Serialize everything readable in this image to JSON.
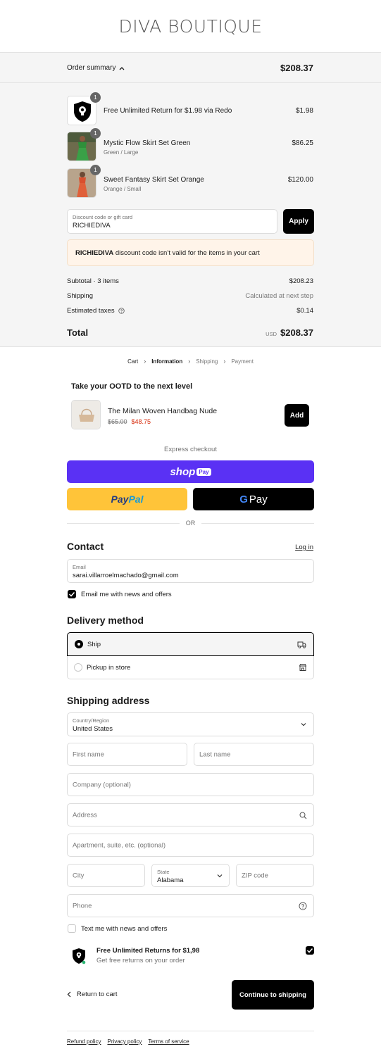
{
  "brand": {
    "logo_text": "DIVA BOUTIQUE"
  },
  "summary": {
    "toggle_label": "Order summary",
    "total": "$208.37",
    "items": [
      {
        "name": "Free Unlimited Return for $1.98 via Redo",
        "variant": "",
        "price": "$1.98",
        "qty": "1",
        "image": "redo-shield-icon"
      },
      {
        "name": "Mystic Flow Skirt Set Green",
        "variant": "Green / Large",
        "price": "$86.25",
        "qty": "1",
        "image": "green-skirt-set-photo"
      },
      {
        "name": "Sweet Fantasy Skirt Set Orange",
        "variant": "Orange / Small",
        "price": "$120.00",
        "qty": "1",
        "image": "orange-skirt-set-photo"
      }
    ],
    "discount": {
      "label": "Discount code or gift card",
      "value": "RICHIEDIVA",
      "apply_label": "Apply"
    },
    "notice": {
      "code": "RICHIEDIVA",
      "message": "discount code isn’t valid for the items in your cart"
    },
    "subtotal_label": "Subtotal · 3 items",
    "subtotal_value": "$208.23",
    "shipping_label": "Shipping",
    "shipping_value": "Calculated at next step",
    "taxes_label": "Estimated taxes",
    "taxes_value": "$0.14",
    "total_label": "Total",
    "currency": "USD",
    "total_value": "$208.37"
  },
  "breadcrumbs": [
    "Cart",
    "Information",
    "Shipping",
    "Payment"
  ],
  "upsell": {
    "title": "Take your OOTD to the next level",
    "product": "The Milan Woven Handbag Nude",
    "old_price": "$65.00",
    "new_price": "$48.75",
    "add_label": "Add"
  },
  "express": {
    "label": "Express checkout",
    "shop_text": "shop",
    "shop_pay_badge": "Pay",
    "paypal_text_1": "Pay",
    "paypal_text_2": "Pal",
    "gpay_g": "G",
    "gpay_text": "Pay",
    "or_label": "OR"
  },
  "contact": {
    "title": "Contact",
    "login_label": "Log in",
    "email_label": "Email",
    "email_value": "sarai.villarroelmachado@gmail.com",
    "newsletter_label": "Email me with news and offers"
  },
  "delivery": {
    "title": "Delivery method",
    "options": [
      {
        "label": "Ship",
        "selected": true,
        "icon": "truck-icon"
      },
      {
        "label": "Pickup in store",
        "selected": false,
        "icon": "store-icon"
      }
    ]
  },
  "shipping_address": {
    "title": "Shipping address",
    "country_label": "Country/Region",
    "country_value": "United States",
    "first_name_ph": "First name",
    "last_name_ph": "Last name",
    "company_ph": "Company (optional)",
    "address_ph": "Address",
    "apartment_ph": "Apartment, suite, etc. (optional)",
    "city_ph": "City",
    "state_label": "State",
    "state_value": "Alabama",
    "zip_ph": "ZIP code",
    "phone_ph": "Phone",
    "sms_label": "Text me with news and offers"
  },
  "returns": {
    "title": "Free Unlimited Returns for $1,98",
    "subtitle": "Get free returns on your order"
  },
  "actions": {
    "return_label": "Return to cart",
    "continue_label": "Continue to shipping"
  },
  "footer": {
    "links": [
      "Refund policy",
      "Privacy policy",
      "Terms of service"
    ]
  },
  "colors": {
    "shop_pay": "#5a31f4",
    "paypal_yellow": "#ffc439",
    "error_red": "#d72c0d"
  }
}
